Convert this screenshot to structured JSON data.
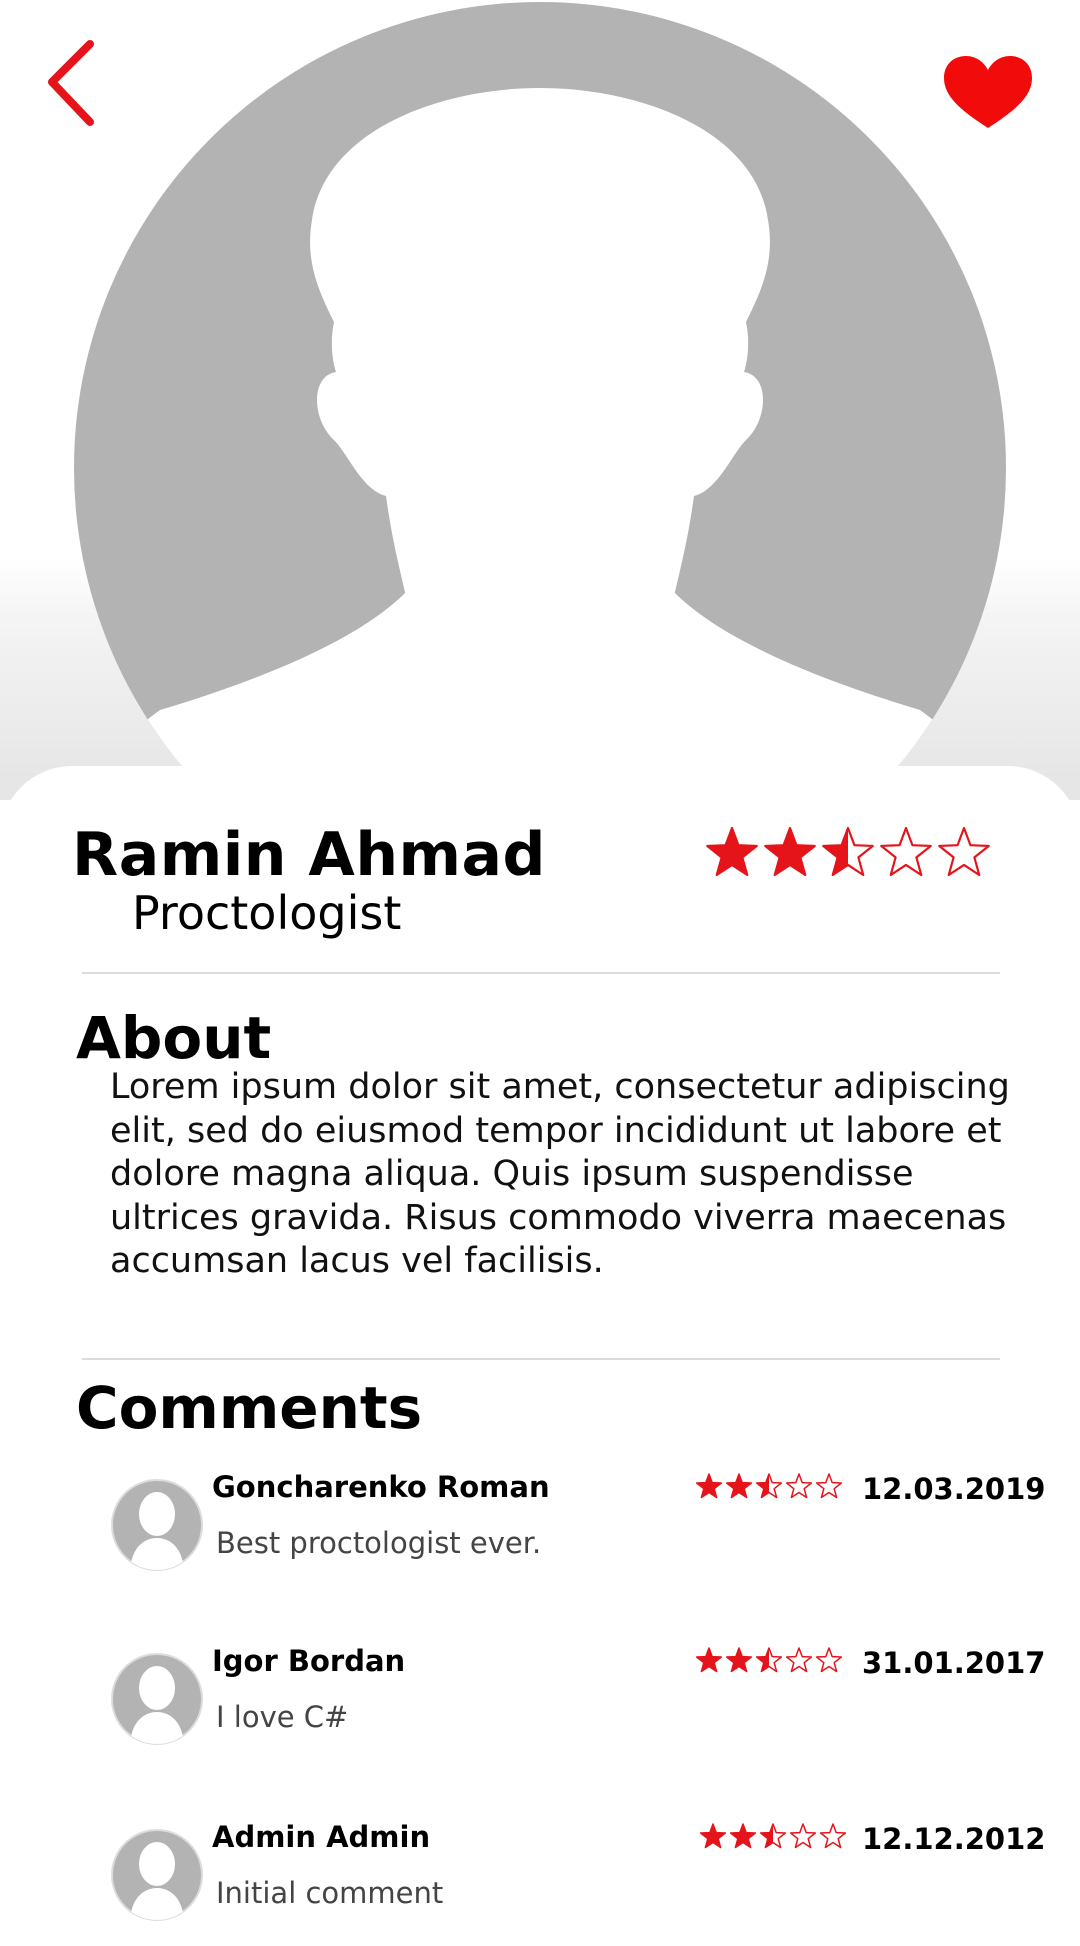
{
  "colors": {
    "accent": "#e4141a",
    "placeholder_gray": "#b4b3b4",
    "divider": "#dcdcdc"
  },
  "header": {
    "back_icon": "chevron-left-icon",
    "favorite_icon": "heart-icon"
  },
  "profile": {
    "photo": "person-silhouette-icon",
    "name": "Ramin Ahmad",
    "specialty": "Proctologist",
    "rating": {
      "value": 2.5,
      "max": 5
    }
  },
  "about": {
    "title": "About",
    "text": "Lorem ipsum dolor sit amet, consectetur adipiscing elit, sed do eiusmod tempor incididunt ut labore et dolore magna aliqua. Quis ipsum suspendisse ultrices gravida. Risus commodo viverra maecenas accumsan lacus vel facilisis."
  },
  "comments": {
    "title": "Comments",
    "items": [
      {
        "author": "Goncharenko Roman",
        "text": "Best proctologist ever.",
        "rating": 2.5,
        "date": "12.03.2019"
      },
      {
        "author": "Igor Bordan",
        "text": "I love C#",
        "rating": 2.5,
        "date": "31.01.2017"
      },
      {
        "author": "Admin Admin",
        "text": "Initial comment",
        "rating": 2.5,
        "date": "12.12.2012"
      }
    ]
  }
}
